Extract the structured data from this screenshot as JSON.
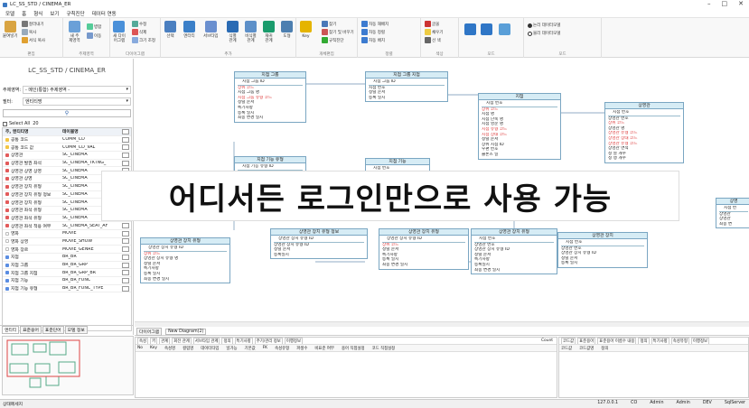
{
  "window": {
    "title": "LC_SS_STD / CINEMA_ER",
    "min": "–",
    "restore": "□",
    "close": "✕"
  },
  "menu": [
    "모델",
    "홈",
    "형식",
    "보기",
    "규칙진단",
    "데이터 연동"
  ],
  "ribbon": {
    "groups": [
      {
        "label": "편집"
      },
      {
        "label": "주제영역"
      },
      {
        "label": "다이어그램"
      },
      {
        "label": "추가"
      },
      {
        "label": "개체편집"
      },
      {
        "label": "정렬"
      },
      {
        "label": "색상"
      },
      {
        "label": "모드"
      },
      {
        "label": "모드"
      }
    ],
    "buttons": {
      "paste": "붙여넣기",
      "cut": "잘라내기",
      "copy": "복사",
      "format_copy": "서식 복사",
      "new_subject": "새 주\n제영역",
      "merge": "병합",
      "move": "이동",
      "edit": "수정",
      "delete": "삭제",
      "size_adjust": "크기 조정",
      "new_diagram": "새 다이\n어그램",
      "select": "선택",
      "entity": "엔터티",
      "subtype": "서브타입",
      "relation": "식별\n관계",
      "nonid_relation": "비식별\n관계",
      "recursive_relation": "재귀\n관계",
      "shape": "도형",
      "key": "Key",
      "find": "찾기",
      "find_replace": "찾기 및 바꾸기",
      "rule_check": "규칙진단",
      "auto_arrange": "자동 재배치",
      "align": "자동 정렬",
      "auto_layout": "자동 배치",
      "font_color": "글꼴",
      "fill_color": "채우기",
      "line_color": "선 색",
      "logical": "논리 데이터모델",
      "physical": "물리 데이터모델"
    }
  },
  "left": {
    "project_title": "LC_SS_STD / CINEMA_ER",
    "subject_label": "주제영역:",
    "subject_value": "- 메인(통합) 주제영역 -",
    "filter_label": "필터:",
    "filter_value": "엔티티명",
    "select_all": "Select All",
    "count": "20",
    "col_entity": "주, 엔티티명",
    "col_table": "테이블명",
    "rows": [
      {
        "entity": "공통 코드",
        "table": "COMM_CD",
        "color": "#f4c542"
      },
      {
        "entity": "공통 코드 값",
        "table": "COMM_CD_VAL",
        "color": "#f4c542"
      },
      {
        "entity": "상영관",
        "table": "SC_CINEMA",
        "color": "#e25a5a"
      },
      {
        "entity": "상영관 발권 좌석",
        "table": "SC_CINEMA_TKTNG_",
        "color": "#e25a5a"
      },
      {
        "entity": "상영관 상영 상영",
        "table": "SC_CINEMA",
        "color": "#e25a5a"
      },
      {
        "entity": "상영관 상영",
        "table": "SC_CINEMA",
        "color": "#e25a5a"
      },
      {
        "entity": "상영관 장치 유형",
        "table": "SC_CINEMA",
        "color": "#e25a5a"
      },
      {
        "entity": "상영관 장치 유형 정보",
        "table": "SC_CINEMA",
        "color": "#e25a5a"
      },
      {
        "entity": "상영관 장치 유형",
        "table": "SC_CINEMA",
        "color": "#e25a5a"
      },
      {
        "entity": "상영관 좌석 유형",
        "table": "SC_CINEMA",
        "color": "#e25a5a"
      },
      {
        "entity": "상영관 좌석 유형",
        "table": "SC_CINEMA",
        "color": "#e25a5a"
      },
      {
        "entity": "상영관 좌석 적용 여부",
        "table": "SC_CINEMA_SEAT_AF",
        "color": "#e25a5a"
      },
      {
        "entity": "영화",
        "table": "MOVIE",
        "color": "#ffffff"
      },
      {
        "entity": "영화 상영",
        "table": "MOVIE_SHOW",
        "color": "#ffffff"
      },
      {
        "entity": "영화 장르",
        "table": "MOVIE_GENRE",
        "color": "#ffffff"
      },
      {
        "entity": "지점",
        "table": "BR_BR",
        "color": "#5a8de2"
      },
      {
        "entity": "지점 그룹",
        "table": "BR_BR_GRP",
        "color": "#5a8de2"
      },
      {
        "entity": "지점 그룹 지점",
        "table": "BR_BR_GRP_BR",
        "color": "#5a8de2"
      },
      {
        "entity": "지점 기능",
        "table": "BR_BR_FUNC",
        "color": "#5a8de2"
      },
      {
        "entity": "지점 기능 유형",
        "table": "BR_BR_FUNC_TYPE",
        "color": "#5a8de2"
      }
    ],
    "tabs": [
      "엔티티",
      "표준용어",
      "표준단어",
      "모델 정보"
    ]
  },
  "canvas": {
    "entities": [
      {
        "id": "e1",
        "title": "지점 그룹",
        "attrs": [
          "지점 그룹 ID",
          "상위 코드",
          "지점 그룹 명",
          "지점 그룹 유형 코드",
          "정렬 순서",
          "특기사항",
          "등록 일시",
          "최종 변경 일시"
        ],
        "red": [
          1,
          3
        ]
      },
      {
        "id": "e2",
        "title": "지점 그룹 지점",
        "attrs": [
          "지점 그룹 ID",
          "지점 번호",
          "정렬 순서",
          "등록 일시"
        ],
        "red": []
      },
      {
        "id": "e3",
        "title": "지점",
        "attrs": [
          "지점 번호",
          "상위 코드",
          "지점 명",
          "지점 단축 명",
          "지점 영문 명",
          "지점 유형 코드",
          "지점 상태 코드",
          "정렬 순서",
          "상위 지점 ID",
          "우편 번호",
          "클론즈 일"
        ],
        "red": [
          1,
          5,
          6
        ]
      },
      {
        "id": "e4",
        "title": "상영관",
        "attrs": [
          "지점 번호",
          "상영관 번호",
          "상위 코드",
          "상영관 명",
          "상영관 유형 코드",
          "상영관 상태 코드",
          "상영관 유형 코드",
          "상영관 면적",
          "정 열 개수",
          "정 행 개수"
        ],
        "red": [
          2,
          4,
          5,
          6
        ]
      },
      {
        "id": "e5",
        "title": "지점 기능 유형",
        "attrs": [
          "지점 기능 유형 ID"
        ],
        "red": []
      },
      {
        "id": "e6",
        "title": "지점 기능",
        "attrs": [
          "지점 번호"
        ],
        "red": []
      },
      {
        "id": "e7",
        "title": "상영관 장치 유형",
        "attrs": [
          "상영관 장치 유형 ID",
          "상위 코드",
          "상영관 장치 유형 명",
          "정렬 순서",
          "특기사항",
          "등록 일시",
          "최종 변경 일시"
        ],
        "red": [
          1
        ]
      },
      {
        "id": "e8",
        "title": "상영관 장치 유형 정보",
        "attrs": [
          "상영관 장치 유형 ID",
          "상영관 장치 유형 ID",
          "정렬 순서",
          "등록일시"
        ],
        "red": []
      },
      {
        "id": "e9",
        "title": "상영관 장치 유형",
        "attrs": [
          "상영관 장치 유형 ID",
          "상위 코드",
          "정렬 순서",
          "특기사항",
          "등록 일시",
          "최종 변경 일시"
        ],
        "red": [
          1
        ]
      },
      {
        "id": "e10",
        "title": "상영관 장치 유형",
        "attrs": [
          "지점 번호",
          "상영관 번호",
          "상영관 장치 유형 ID",
          "정렬 순서",
          "특기사항",
          "등록일시",
          "최종 변경 일시"
        ],
        "red": []
      },
      {
        "id": "e11",
        "title": "상영관 장치",
        "attrs": [
          "지점 번호",
          "상영관 번호",
          "상영관 장치 유형 ID",
          "정렬 순서",
          "등록 일시"
        ],
        "red": []
      },
      {
        "id": "e12",
        "title": "상영",
        "attrs": [
          "지점 번",
          "상영관",
          "상영관",
          "최종 변"
        ],
        "red": []
      }
    ],
    "banner": "어디서든 로그인만으로 사용 가능"
  },
  "diagram_tabs": [
    "다이어그램",
    "New Diagram(2)"
  ],
  "attr_panel": {
    "tabs": [
      "속성",
      "키",
      "관계",
      "회전 관계",
      "서브타입 관계",
      "정의",
      "특기사항",
      "주기/관리 정보",
      "이행정보"
    ],
    "count_label": "Count",
    "cols": [
      "No",
      "Key",
      "속성명",
      "컬럼명",
      "데이터타입",
      "널가능",
      "기본값",
      "FK",
      "속성유형",
      "파생수",
      "비표준 여부",
      "용어 직접설정",
      "코드 직접설정"
    ]
  },
  "code_panel": {
    "tabs": [
      "코드값",
      "표준용어",
      "표준용어 이름수 내용",
      "정의",
      "특기사항",
      "속성유형",
      "이행정보"
    ],
    "cols": [
      "코드값",
      "코드값명",
      "정의"
    ]
  },
  "status": {
    "left": "상태메세지",
    "ip": "127.0.0.1",
    "co": "CO",
    "user": "Admin",
    "role": "Admin",
    "env": "DEV",
    "db": "SqlServer"
  }
}
